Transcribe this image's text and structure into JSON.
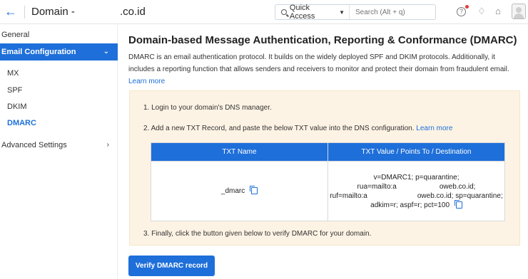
{
  "header": {
    "back_icon": "arrow-left-icon",
    "domain_prefix": "Domain - ",
    "domain_suffix": ".co.id",
    "quick_access_label": "Quick Access",
    "search_placeholder": "Search (Alt + q)",
    "icons": [
      "help-icon",
      "bell-icon",
      "home-icon",
      "avatar"
    ],
    "notification_dot_color": "#e53935"
  },
  "sidebar": {
    "items": [
      {
        "label": "General"
      },
      {
        "label": "Email Configuration",
        "active": true
      },
      {
        "label": "MX"
      },
      {
        "label": "SPF"
      },
      {
        "label": "DKIM"
      },
      {
        "label": "DMARC",
        "active": true
      },
      {
        "label": "Advanced Settings"
      }
    ],
    "accent_color": "#1e6fd9"
  },
  "main": {
    "title": "Domain-based Message Authentication, Reporting & Conformance (DMARC)",
    "description": "DMARC is an email authentication protocol. It builds on the widely deployed SPF and DKIM protocols. Additionally, it includes a reporting function that allows senders and receivers to monitor and protect their domain from fraudulent email.",
    "description_link": "Learn more",
    "steps": {
      "step1": "1. Login to your domain's DNS manager.",
      "step2": "2. Add a new TXT Record, and paste the below TXT value into the DNS configuration.",
      "step2_link": "Learn more",
      "step3": "3. Finally, click the button given below to verify DMARC for your domain."
    },
    "table": {
      "headers": [
        "TXT Name",
        "TXT Value / Points To / Destination"
      ],
      "row": {
        "name": "_dmarc",
        "value_lines": [
          "v=DMARC1; p=quarantine;",
          "rua=mailto:a      oweb.co.id;",
          "ruf=mailto:a       oweb.co.id; sp=quarantine;",
          "adkim=r; aspf=r; pct=100"
        ]
      }
    },
    "verify_button": "Verify DMARC record",
    "panel_bg": "#fdf3e4"
  }
}
